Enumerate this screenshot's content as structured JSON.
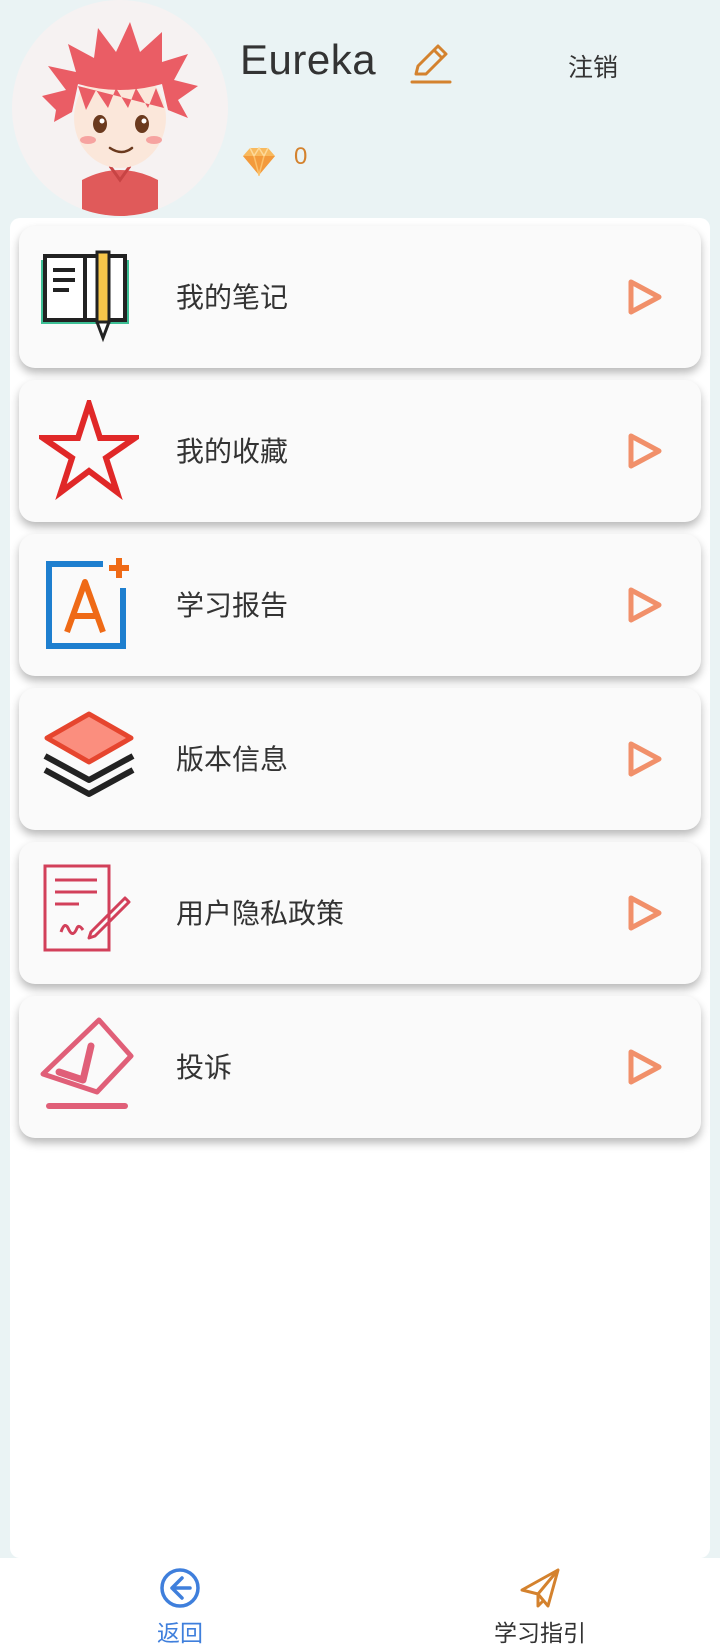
{
  "profile": {
    "username": "Eureka",
    "logout_label": "注销",
    "gem_count": "0",
    "avatar_icon": "cartoon-boy-avatar",
    "edit_icon": "pencil-icon",
    "gem_icon": "diamond-icon"
  },
  "menu": {
    "items": [
      {
        "label": "我的笔记",
        "icon": "notebook-icon"
      },
      {
        "label": "我的收藏",
        "icon": "star-icon"
      },
      {
        "label": "学习报告",
        "icon": "report-grade-icon"
      },
      {
        "label": "版本信息",
        "icon": "layers-icon"
      },
      {
        "label": "用户隐私政策",
        "icon": "signed-document-icon"
      },
      {
        "label": "投诉",
        "icon": "complaint-ballot-icon"
      }
    ],
    "arrow_icon": "play-arrow-icon"
  },
  "bottom_nav": {
    "back_label": "返回",
    "guide_label": "学习指引",
    "back_icon": "back-circle-arrow-icon",
    "guide_icon": "paper-plane-icon"
  },
  "colors": {
    "accent_orange": "#d4822e",
    "arrow": "#f1906a",
    "nav_active": "#3f7fdc",
    "background": "#eaf3f4"
  }
}
